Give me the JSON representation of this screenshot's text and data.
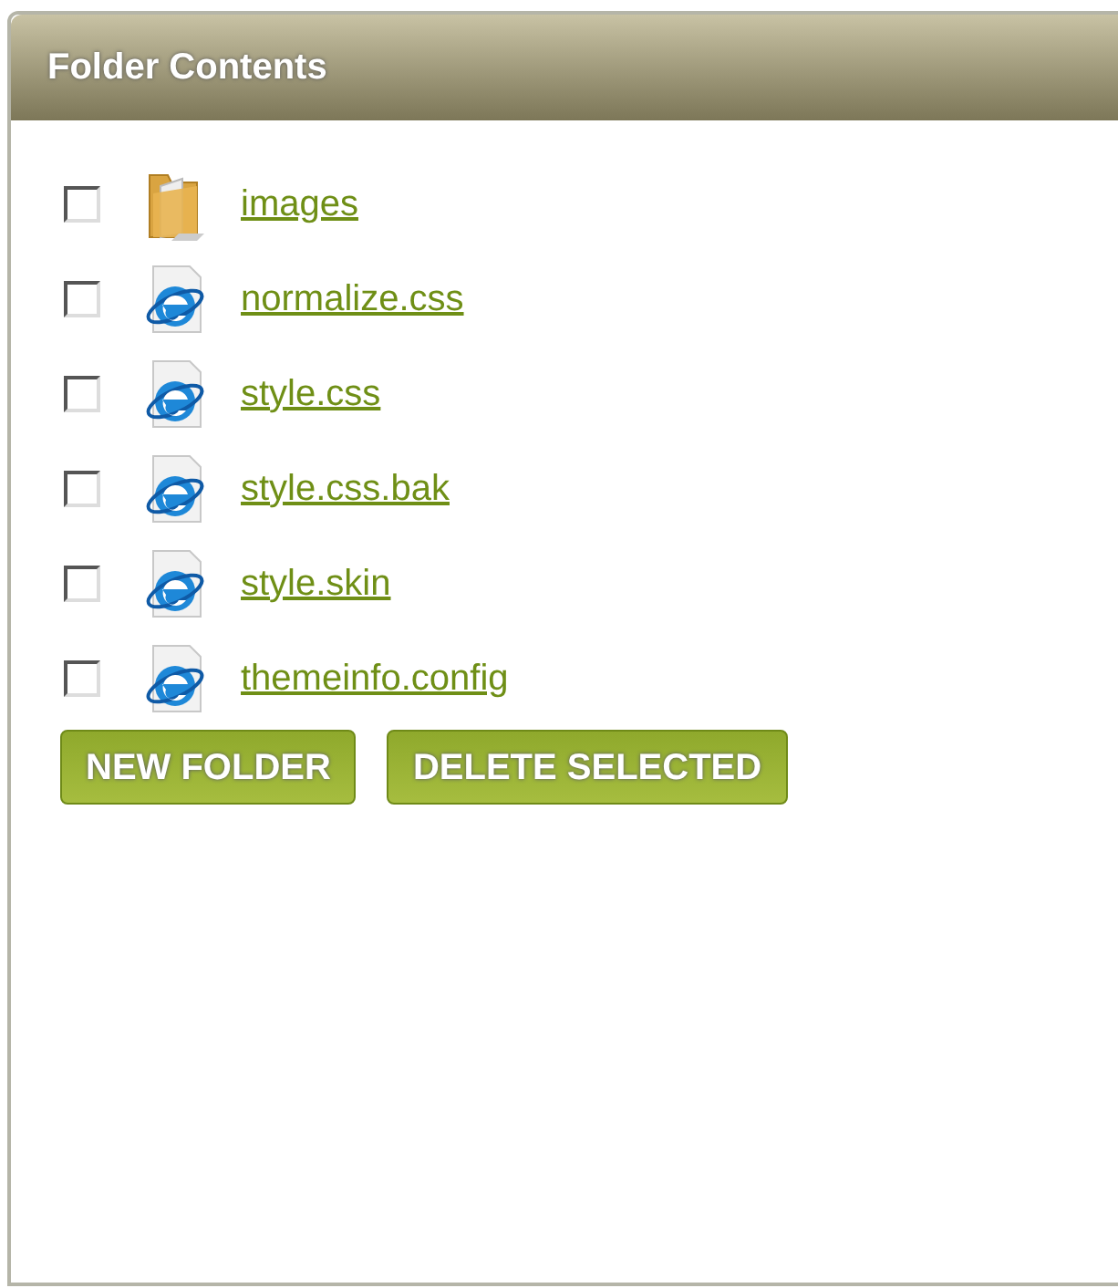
{
  "panel": {
    "title": "Folder Contents"
  },
  "items": [
    {
      "kind": "folder",
      "name": "images",
      "checked": false
    },
    {
      "kind": "file",
      "name": "normalize.css",
      "checked": false
    },
    {
      "kind": "file",
      "name": "style.css",
      "checked": false
    },
    {
      "kind": "file",
      "name": "style.css.bak",
      "checked": false
    },
    {
      "kind": "file",
      "name": "style.skin",
      "checked": false
    },
    {
      "kind": "file",
      "name": "themeinfo.config",
      "checked": false
    }
  ],
  "buttons": [
    "NEW FOLDER",
    "DELETE SELECTED"
  ]
}
